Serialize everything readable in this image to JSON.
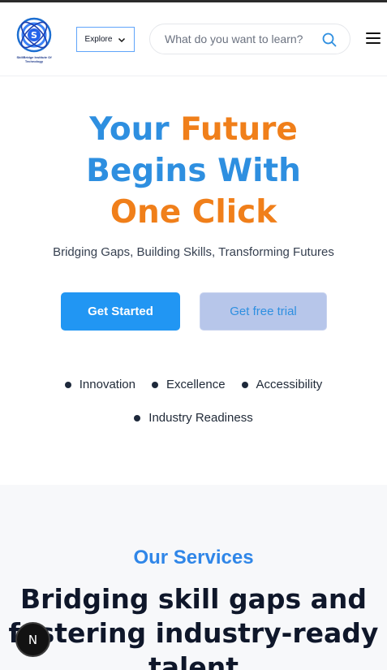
{
  "header": {
    "logo_text": "SkillBridge Institute Of Technology",
    "explore_label": "Explore",
    "search_placeholder": "What do you want to learn?"
  },
  "hero": {
    "title_line1_a": "Your ",
    "title_line1_b": "Future",
    "title_line2": "Begins With",
    "title_line3": "One Click",
    "subtitle": "Bridging Gaps, Building Skills, Transforming Futures",
    "primary_button": "Get Started",
    "secondary_button": "Get free trial",
    "bullets": [
      "Innovation",
      "Excellence",
      "Accessibility",
      "Industry Readiness"
    ]
  },
  "services": {
    "label": "Our Services",
    "heading_line1": "Bridging skill gaps and",
    "heading_line2": "fostering industry-ready",
    "heading_line3": "talent"
  },
  "badge": {
    "letter": "N"
  },
  "colors": {
    "accent_blue": "#2e8fe0",
    "accent_orange": "#f07f1a",
    "button_blue": "#2196f3",
    "button_secondary_bg": "#b7c6ea"
  }
}
